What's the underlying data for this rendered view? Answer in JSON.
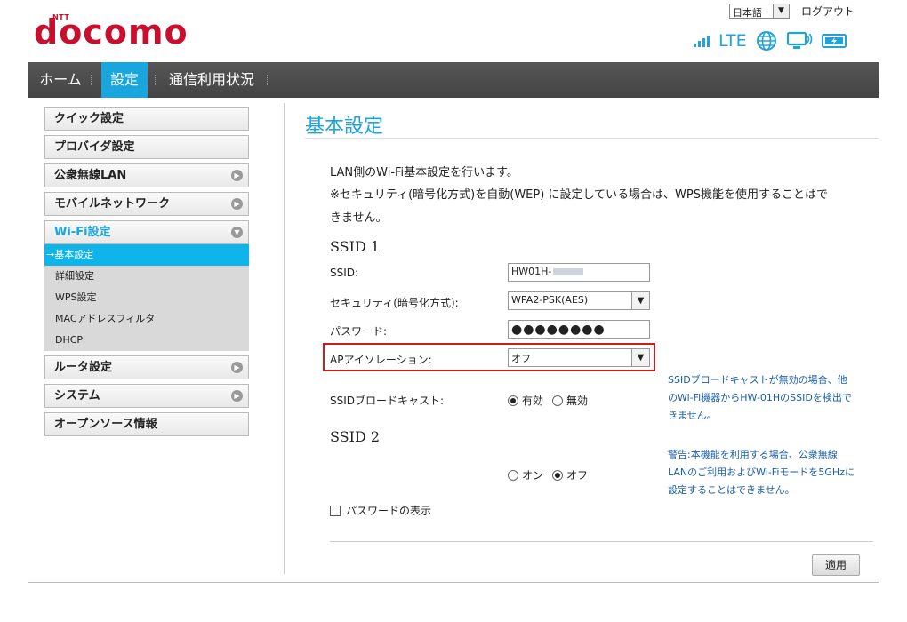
{
  "header": {
    "brand_small": "NTT",
    "brand": "docomo",
    "language": "日本語",
    "logout": "ログアウト",
    "network_type": "LTE"
  },
  "nav": {
    "tabs": [
      {
        "label": "ホーム",
        "active": false
      },
      {
        "label": "設定",
        "active": true
      },
      {
        "label": "通信利用状況",
        "active": false
      }
    ]
  },
  "sidebar": {
    "items": [
      {
        "label": "クイック設定"
      },
      {
        "label": "プロバイダ設定"
      },
      {
        "label": "公衆無線LAN"
      },
      {
        "label": "モバイルネットワーク"
      },
      {
        "label": "Wi-Fi設定"
      },
      {
        "label": "ルータ設定"
      },
      {
        "label": "システム"
      },
      {
        "label": "オープンソース情報"
      }
    ],
    "wifi_sub": [
      {
        "label": "→基本設定",
        "active": true
      },
      {
        "label": "詳細設定"
      },
      {
        "label": "WPS設定"
      },
      {
        "label": "MACアドレスフィルタ"
      },
      {
        "label": "DHCP"
      }
    ]
  },
  "main": {
    "title": "基本設定",
    "desc1": "LAN側のWi-Fi基本設定を行います。",
    "desc2": "※セキュリティ(暗号化方式)を自動(WEP) に設定している場合は、WPS機能を使用することはで",
    "desc3": "きません。",
    "ssid1_title": "SSID 1",
    "ssid_label": "SSID:",
    "ssid_value": "HW01H-",
    "security_label": "セキュリティ(暗号化方式):",
    "security_value": "WPA2-PSK(AES)",
    "password_label": "パスワード:",
    "password_value": "●●●●●●●●",
    "ap_isolation_label": "APアイソレーション:",
    "ap_isolation_value": "オフ",
    "broadcast_label": "SSIDブロードキャスト:",
    "broadcast_on": "有効",
    "broadcast_off": "無効",
    "broadcast_selected": "有効",
    "broadcast_note": "SSIDブロードキャストが無効の場合、他のWi-Fi機器からHW-01HのSSIDを検出できません。",
    "ssid2_title": "SSID 2",
    "ssid2_on": "オン",
    "ssid2_off": "オフ",
    "ssid2_selected": "オフ",
    "warning_note": "警告:本機能を利用する場合、公衆無線LANのご利用およびWi-Fiモードを5GHzに設定することはできません。",
    "show_password": "パスワードの表示",
    "apply": "適用"
  },
  "colors": {
    "accent": "#1aa6dd",
    "brand": "#c8102e",
    "highlight": "#c81e1e",
    "note": "#1a5fa8"
  },
  "icons": [
    "signal-bars-icon",
    "globe-icon",
    "monitor-icon",
    "battery-icon",
    "circle-arrow-icon",
    "chevron-down-icon"
  ]
}
